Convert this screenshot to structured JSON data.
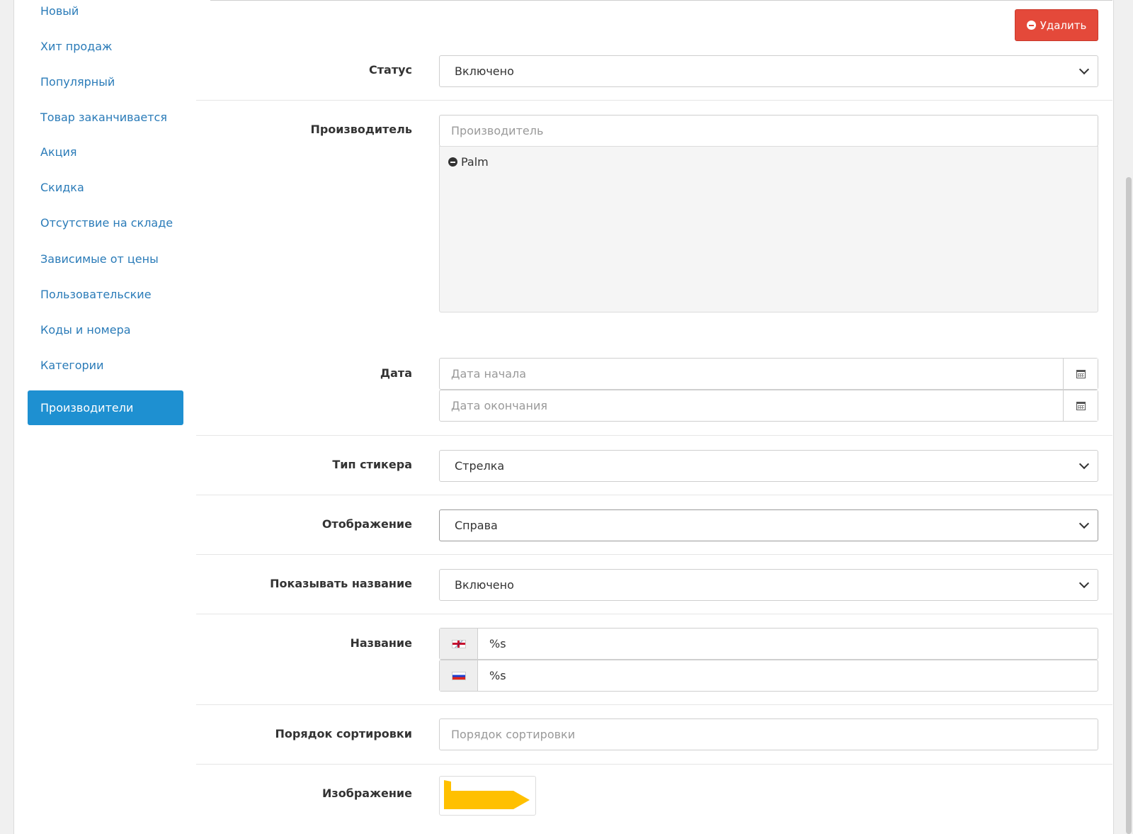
{
  "sidebar": {
    "items": [
      {
        "label": "Новый"
      },
      {
        "label": "Хит продаж"
      },
      {
        "label": "Популярный"
      },
      {
        "label": "Товар заканчивается"
      },
      {
        "label": "Акция"
      },
      {
        "label": "Скидка"
      },
      {
        "label": "Отсутствие на складе"
      },
      {
        "label": "Зависимые от цены"
      },
      {
        "label": "Пользовательские"
      },
      {
        "label": "Коды и номера"
      },
      {
        "label": "Категории"
      },
      {
        "label": "Производители",
        "active": true
      }
    ]
  },
  "toolbar": {
    "delete_label": "Удалить",
    "delete_color": "#e4493a"
  },
  "form": {
    "status": {
      "label": "Статус",
      "value": "Включено"
    },
    "manufacturer": {
      "label": "Производитель",
      "placeholder": "Производитель",
      "selected": [
        "Palm"
      ]
    },
    "date": {
      "label": "Дата",
      "start_placeholder": "Дата начала",
      "end_placeholder": "Дата окончания"
    },
    "sticker_type": {
      "label": "Тип стикера",
      "value": "Стрелка"
    },
    "display": {
      "label": "Отображение",
      "value": "Справа"
    },
    "show_name": {
      "label": "Показывать название",
      "value": "Включено"
    },
    "name": {
      "label": "Название",
      "values": [
        {
          "flag": "flag-en-icon",
          "value": "%s"
        },
        {
          "flag": "flag-ru-icon",
          "value": "%s"
        }
      ]
    },
    "sort_order": {
      "label": "Порядок сортировки",
      "placeholder": "Порядок сортировки"
    },
    "image": {
      "label": "Изображение",
      "sticker_color": "#ffc000"
    }
  },
  "colors": {
    "accent": "#1e90d1",
    "link": "#2a7bb8"
  }
}
